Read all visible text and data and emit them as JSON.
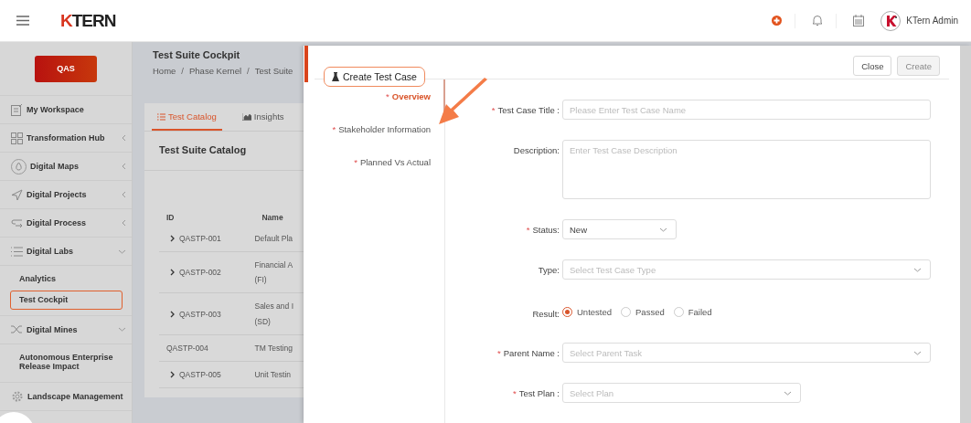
{
  "header": {
    "logo": "KTERN",
    "user": "KTern Admin"
  },
  "sidebar": {
    "env_badge": "QAS",
    "items": [
      {
        "label": "My Workspace",
        "kind": "link"
      },
      {
        "label": "Transformation Hub",
        "kind": "group",
        "expanded": false
      },
      {
        "label": "Digital Maps",
        "kind": "group",
        "expanded": false
      },
      {
        "label": "Digital Projects",
        "kind": "group",
        "expanded": false
      },
      {
        "label": "Digital Process",
        "kind": "group",
        "expanded": false
      },
      {
        "label": "Digital Labs",
        "kind": "group",
        "expanded": true,
        "children": [
          {
            "label": "Analytics",
            "highlighted": false
          },
          {
            "label": "Test Cockpit",
            "highlighted": true
          }
        ]
      },
      {
        "label": "Digital Mines",
        "kind": "group",
        "expanded": true,
        "children": [
          {
            "label": "Autonomous Enterprise Release Impact",
            "highlighted": false
          }
        ]
      },
      {
        "label": "Landscape Management",
        "kind": "link"
      }
    ]
  },
  "page": {
    "title": "Test Suite Cockpit",
    "breadcrumb": [
      {
        "kind": "link",
        "text": "Home"
      },
      {
        "kind": "separator",
        "text": "/"
      },
      {
        "kind": "link",
        "text": "Phase Kernel"
      },
      {
        "kind": "separator",
        "text": "/"
      },
      {
        "kind": "link",
        "text": "Test Suite"
      }
    ],
    "tabs": [
      {
        "label": "Test Catalog",
        "selected": true
      },
      {
        "label": "Insights",
        "selected": false
      }
    ],
    "card_title": "Test Suite Catalog",
    "table": {
      "columns": [
        "ID",
        "Name"
      ],
      "rows": [
        {
          "id": "QASTP-001",
          "name_lines": [
            "Default Pla"
          ],
          "expandable": true
        },
        {
          "id": "QASTP-002",
          "name_lines": [
            "Financial A",
            "(FI)"
          ],
          "expandable": true
        },
        {
          "id": "QASTP-003",
          "name_lines": [
            "Sales and I",
            "(SD)"
          ],
          "expandable": true
        },
        {
          "id": "QASTP-004",
          "name_lines": [
            "TM Testing"
          ],
          "expandable": false
        },
        {
          "id": "QASTP-005",
          "name_lines": [
            "Unit Testin"
          ],
          "expandable": true
        }
      ]
    }
  },
  "drawer": {
    "buttons": [
      {
        "label": "Close",
        "disabled": false
      },
      {
        "label": "Create",
        "disabled": true
      }
    ],
    "section_title": {
      "label": "Create Test Case",
      "highlighted": true
    },
    "steps": [
      {
        "label": "Overview",
        "required_mark": "*",
        "selected": true
      },
      {
        "label": "Stakeholder Information",
        "required_mark": "*",
        "selected": false
      },
      {
        "label": "Planned Vs Actual",
        "required_mark": "*",
        "selected": false
      }
    ],
    "fields": [
      {
        "label": "Test Case Title :",
        "kind": "input",
        "required_mark": "*",
        "placeholder": "Please Enter Test Case Name"
      },
      {
        "label": "Description:",
        "kind": "textarea",
        "placeholder": "Enter Test Case Description"
      },
      {
        "label": "Status:",
        "kind": "select",
        "required_mark": "*",
        "value": "New"
      },
      {
        "label": "Type:",
        "kind": "select",
        "placeholder": "Select Test Case Type"
      },
      {
        "label": "Result:",
        "kind": "radio",
        "options": [
          {
            "label": "Untested",
            "selected": true
          },
          {
            "label": "Passed",
            "selected": false
          },
          {
            "label": "Failed",
            "selected": false
          }
        ]
      },
      {
        "label": "Parent Name :",
        "kind": "select",
        "required_mark": "*",
        "placeholder": "Select Parent Task"
      },
      {
        "label": "Test Plan :",
        "kind": "select",
        "required_mark": "*",
        "placeholder": "Select Plan"
      }
    ]
  }
}
